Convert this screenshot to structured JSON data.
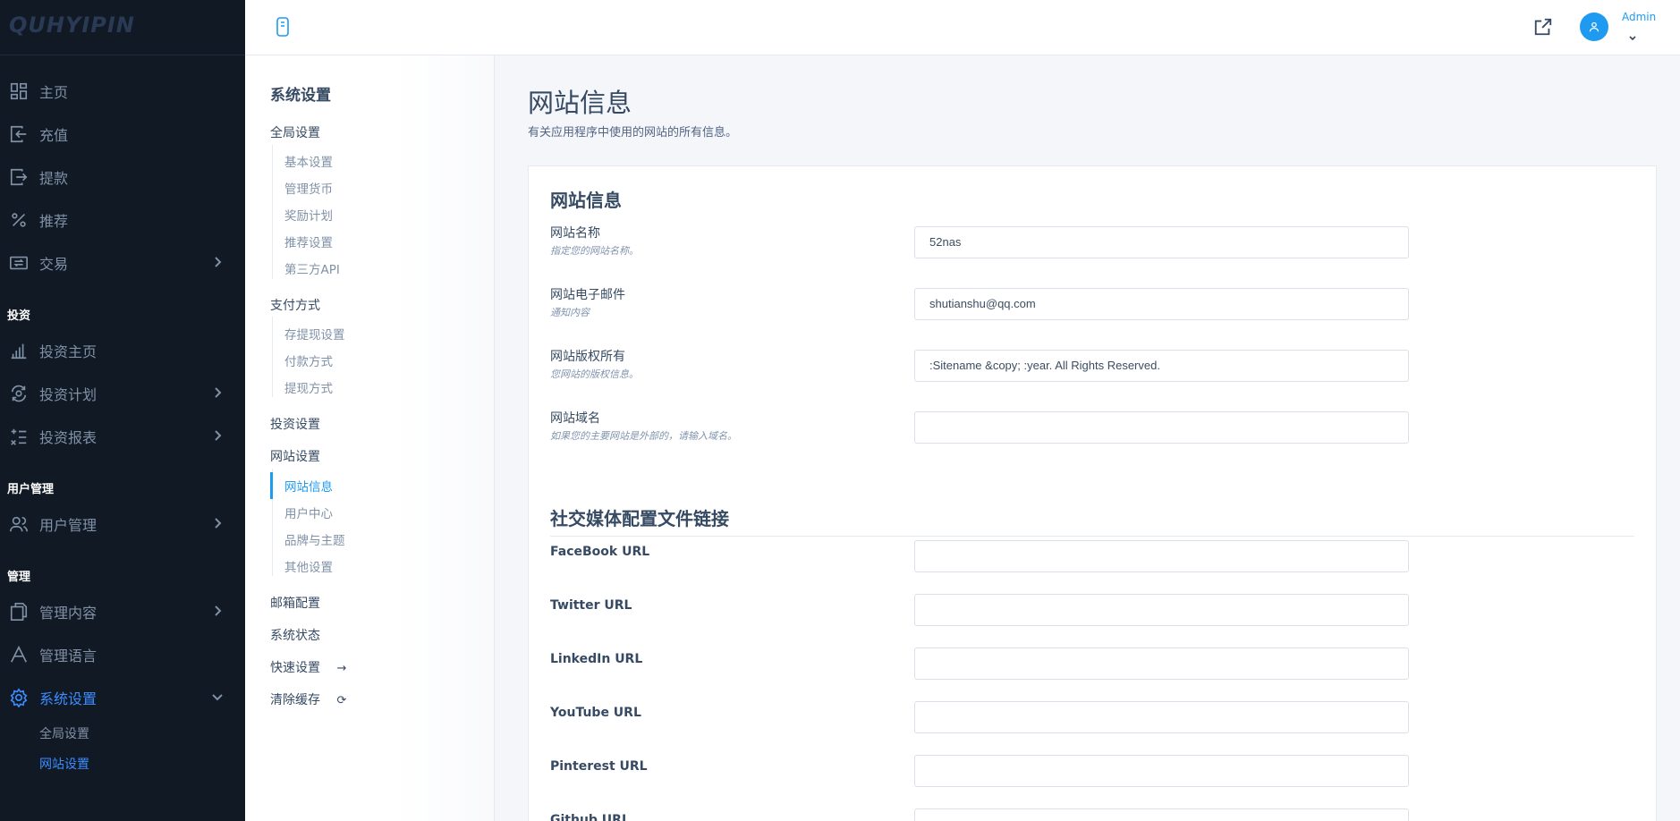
{
  "logo": {
    "text": "QUHYIPIN"
  },
  "sidebar": {
    "items_top": [
      {
        "label": "主页",
        "icon": "dashboard-icon"
      },
      {
        "label": "充值",
        "icon": "deposit-icon"
      },
      {
        "label": "提款",
        "icon": "withdraw-icon"
      },
      {
        "label": "推荐",
        "icon": "percent-icon"
      },
      {
        "label": "交易",
        "icon": "exchange-icon"
      }
    ],
    "head_invest": "投资",
    "items_invest": [
      {
        "label": "投资主页",
        "icon": "bar-chart-icon"
      },
      {
        "label": "投资计划",
        "icon": "cycle-icon"
      },
      {
        "label": "投资报表",
        "icon": "list-report-icon"
      }
    ],
    "head_users": "用户管理",
    "items_users": [
      {
        "label": "用户管理",
        "icon": "users-icon"
      }
    ],
    "head_manage": "管理",
    "items_manage": [
      {
        "label": "管理内容",
        "icon": "pages-icon"
      },
      {
        "label": "管理语言",
        "icon": "language-icon"
      },
      {
        "label": "系统设置",
        "icon": "gear-icon"
      }
    ],
    "sub_items": [
      "全局设置",
      "网站设置"
    ]
  },
  "topbar": {
    "user_name": "Admin"
  },
  "subnav": {
    "title": "系统设置",
    "global": "全局设置",
    "global_links": [
      "基本设置",
      "管理货币",
      "奖励计划",
      "推荐设置",
      "第三方API"
    ],
    "payment": "支付方式",
    "payment_links": [
      "存提现设置",
      "付款方式",
      "提现方式"
    ],
    "invest": "投资设置",
    "site": "网站设置",
    "site_links": [
      "网站信息",
      "用户中心",
      "品牌与主题",
      "其他设置"
    ],
    "mail": "邮箱配置",
    "status": "系统状态",
    "quick": "快速设置",
    "cache": "清除缓存"
  },
  "content": {
    "title": "网站信息",
    "subtitle": "有关应用程序中使用的网站的所有信息。",
    "section1": "网站信息",
    "fields": [
      {
        "label": "网站名称",
        "hint": "指定您的网站名称。",
        "value": "52nas"
      },
      {
        "label": "网站电子邮件",
        "hint": "通知内容",
        "value": "shutianshu@qq.com"
      },
      {
        "label": "网站版权所有",
        "hint": "您网站的版权信息。",
        "value": ":Sitename &copy; :year. All Rights Reserved."
      },
      {
        "label": "网站域名",
        "hint": "如果您的主要网站是外部的，请输入域名。",
        "value": ""
      }
    ],
    "section2": "社交媒体配置文件链接",
    "social": [
      {
        "label": "FaceBook URL",
        "value": ""
      },
      {
        "label": "Twitter URL",
        "value": ""
      },
      {
        "label": "LinkedIn URL",
        "value": ""
      },
      {
        "label": "YouTube URL",
        "value": ""
      },
      {
        "label": "Pinterest URL",
        "value": ""
      },
      {
        "label": "Github URL",
        "value": ""
      }
    ]
  }
}
